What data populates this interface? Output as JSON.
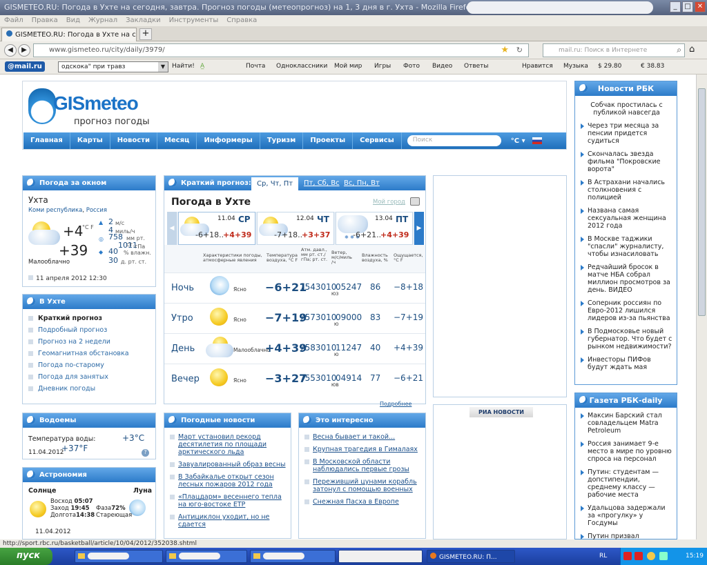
{
  "browser": {
    "title": "GISMETEO.RU: Погода в Ухте на сегодня, завтра. Прогноз погоды (метеопрогноз) на 1, 3 дня в г. Ухта - Mozilla Firefox",
    "menu": [
      "Файл",
      "Правка",
      "Вид",
      "Журнал",
      "Закладки",
      "Инструменты",
      "Справка"
    ],
    "tab_title": "GISMETEO.RU: Погода в Ухте на сегодня,...",
    "url": "www.gismeteo.ru/city/daily/3979/",
    "search_placeholder": "mail.ru: Поиск в Интернете",
    "status_url": "http://sport.rbc.ru/basketball/article/10/04/2012/352038.shtml"
  },
  "mailbar": {
    "logo": "@mail.ru",
    "query": "одскока\" при травз",
    "find": "Найти!",
    "links": [
      "Почта",
      "Одноклассники",
      "Мой мир",
      "Игры",
      "Фото",
      "Видео",
      "Ответы",
      "Нравится",
      "Музыка"
    ],
    "usd": "$ 29.80",
    "eur": "€ 38.83"
  },
  "site": {
    "logo_brand": "GISmeteo",
    "logo_sub": "прогноз погоды",
    "nav": [
      "Главная",
      "Карты",
      "Новости",
      "Месяц",
      "Информеры",
      "Туризм",
      "Проекты",
      "Сервисы"
    ],
    "search_placeholder": "Поиск",
    "unit": "°C ▾"
  },
  "now": {
    "header": "Погода за окном",
    "city": "Ухта",
    "region": "Коми республика",
    "country": "Россия",
    "temp_c": "+4",
    "temp_unit": "°C F",
    "temp_f": "+39",
    "wind_val": "2",
    "wind_unit": "м/с",
    "wind_alt": "4",
    "wind_alt_unit": "миль/ч",
    "pres_val": "758",
    "pres_unit": "мм рт. ст.",
    "pres_alt": "1011",
    "pres_alt_unit": "гПа",
    "hum_val": "40",
    "hum_unit": "% влажн.",
    "days_val": "30",
    "days_unit": "д. рт. ст.",
    "condition": "Малооблачно",
    "date": "11 апреля 2012 12:30"
  },
  "in_city": {
    "header": "В Ухте",
    "items": [
      "Краткий прогноз",
      "Подробный прогноз",
      "Прогноз на 2 недели",
      "Геомагнитная обстановка",
      "Погода по-старому",
      "Погода для занятых",
      "Дневник погоды"
    ]
  },
  "water": {
    "header": "Водоемы",
    "label": "Температура воды:",
    "value_c": "+3°C",
    "value_f": "+37°F",
    "date": "11.04.2012"
  },
  "astro": {
    "header": "Астрономия",
    "sun_label": "Солнце",
    "moon_label": "Луна",
    "rise": "Восход",
    "rise_t": "05:07",
    "set": "Заход",
    "set_t": "19:45",
    "len": "Долгота",
    "len_t": "14:38",
    "phase": "Фаза",
    "phase_v": "72%",
    "phase_name": "Стареющая",
    "date": "11.04.2012"
  },
  "brief": {
    "header": "Краткий прогноз:",
    "tabs": [
      "Ср, Чт, Пт",
      "Пт, Сб, Вс",
      "Вс, Пн, Вт"
    ],
    "city_title": "Погода в Ухте",
    "my_city": "Мой город",
    "days": [
      {
        "date": "11.04",
        "dow": "СР",
        "lo": "-6+18..",
        "hi": "+4+39"
      },
      {
        "date": "12.04",
        "dow": "ЧТ",
        "lo": "-7+18..",
        "hi": "+3+37"
      },
      {
        "date": "13.04",
        "dow": "ПТ",
        "lo": "-6+21..",
        "hi": "+4+39"
      }
    ],
    "col_heads": [
      "Характеристики погоды, атмосферные явления",
      "Температура воздуха, °C F",
      "Атм. давл., мм рт. ст./гПа; рт. ст.",
      "Ветер, м/с/миль /ч",
      "Влажность воздуха, %",
      "Ощущается, °C F"
    ],
    "rows": [
      {
        "period": "Ночь",
        "cond": "Ясно",
        "temp": "−6+21",
        "pres": "7543010",
        "wind": "05247",
        "dir": "ЮЗ",
        "hum": "86",
        "feel": "−8+18"
      },
      {
        "period": "Утро",
        "cond": "Ясно",
        "temp": "−7+19",
        "pres": "7573010",
        "wind": "09000",
        "dir": "Ю",
        "hum": "83",
        "feel": "−7+19"
      },
      {
        "period": "День",
        "cond": "Малооблачно",
        "temp": "+4+39",
        "pres": "7583010",
        "wind": "11247",
        "dir": "Ю",
        "hum": "40",
        "feel": "+4+39"
      },
      {
        "period": "Вечер",
        "cond": "Ясно",
        "temp": "−3+27",
        "pres": "7553010",
        "wind": "04914",
        "dir": "ЮВ",
        "hum": "77",
        "feel": "−6+21"
      }
    ],
    "more": "Подробнее"
  },
  "wnews": {
    "header": "Погодные новости",
    "items": [
      "Март установил рекорд десятилетия по площади арктического льда",
      "Завуалированный образ весны",
      "В Забайкалье открыт сезон лесных пожаров 2012 года",
      "«Плацдарм» весеннего тепла на юго-востоке ЕТР",
      "Антициклон уходит, но не сдается"
    ]
  },
  "interesting": {
    "header": "Это интересно",
    "items": [
      "Весна бывает и такой...",
      "Крупная трагедия в Гималаях",
      "В Московской области наблюдались первые грозы",
      "Переживший цунами корабль затонул с помощью военных",
      "Снежная Пасха в Европе"
    ]
  },
  "ria": "РИА НОВОСТИ",
  "rbc": {
    "header": "Новости РБК",
    "lead": "Собчак простилась с публикой навсегда",
    "items": [
      "Через три месяца за пенсии придется судиться",
      "Скончалась звезда фильма \"Покровские ворота\"",
      "В Астрахани начались столкновения с полицией",
      "Названа самая сексуальная женщина 2012 года",
      "В Москве таджики \"спасли\" журналисту, чтобы изнасиловать",
      "Редчайший бросок в матче НБА собрал миллион просмотров за день. ВИДЕО",
      "Соперник россиян по Евро-2012 лишился лидеров из-за пьянства",
      "В Подмосковье новый губернатор. Что будет с рынком недвижимости?",
      "Инвесторы ПИФов будут ждать мая"
    ]
  },
  "rbcdaily": {
    "header": "Газета РБК-daily",
    "items": [
      "Максин Барский стал совладельцем Matra Petroleum",
      "Россия занимает 9-е место в мире по уровню спроса на персонал",
      "Путин: студентам — допстипендии, среднему классу — рабочие места",
      "Удальцова задержали за «прогулку» у Госдумы",
      "Путин призвал подготовиться к перекройке рынка"
    ]
  },
  "taskbar": {
    "start": "пуск",
    "firefox": "GISMETEO.RU: П...",
    "lang": "RL",
    "clock": "15:19"
  }
}
